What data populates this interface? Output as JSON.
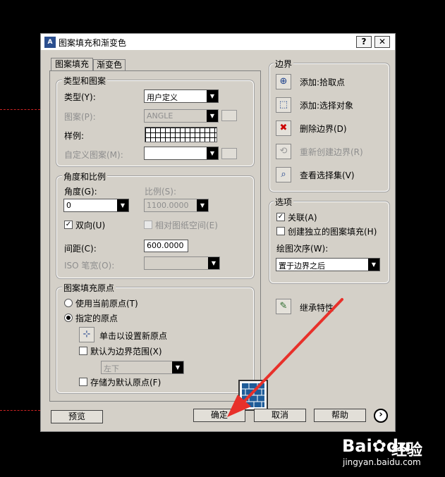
{
  "window": {
    "title": "图案填充和渐变色",
    "help_btn": "?",
    "close_btn": "✕",
    "app_icon_text": "A"
  },
  "tabs": [
    {
      "label": "图案填充"
    },
    {
      "label": "渐变色"
    }
  ],
  "type_pattern": {
    "title": "类型和图案",
    "type_label": "类型(Y):",
    "type_value": "用户定义",
    "pattern_label": "图案(P):",
    "pattern_value": "ANGLE",
    "sample_label": "样例:",
    "custom_label": "自定义图案(M):",
    "custom_value": ""
  },
  "angle_scale": {
    "title": "角度和比例",
    "angle_label": "角度(G):",
    "angle_value": "0",
    "scale_label": "比例(S):",
    "scale_value": "1100.0000",
    "double_label": "双向(U)",
    "relative_label": "相对图纸空间(E)",
    "spacing_label": "间距(C):",
    "spacing_value": "600.0000",
    "iso_label": "ISO 笔宽(O):",
    "iso_value": ""
  },
  "origin": {
    "title": "图案填充原点",
    "use_current_label": "使用当前原点(T)",
    "specified_label": "指定的原点",
    "click_set_label": "单击以设置新原点",
    "default_extent_label": "默认为边界范围(X)",
    "extent_value": "左下",
    "store_default_label": "存储为默认原点(F)"
  },
  "boundary": {
    "title": "边界",
    "add_pick_label": "添加:拾取点",
    "add_select_label": "添加:选择对象",
    "remove_label": "删除边界(D)",
    "recreate_label": "重新创建边界(R)",
    "view_label": "查看选择集(V)"
  },
  "options": {
    "title": "选项",
    "associative_label": "关联(A)",
    "separate_label": "创建独立的图案填充(H)",
    "draw_order_label": "绘图次序(W):",
    "draw_order_value": "置于边界之后"
  },
  "inherit_label": "继承特性",
  "buttons": {
    "preview": "预览",
    "ok": "确定",
    "cancel": "取消",
    "help": "帮助",
    "more": "›"
  },
  "watermark": {
    "brand_left": "Bai",
    "brand_right": "du",
    "brand_cn": "经验",
    "url": "jingyan.baidu.com"
  },
  "colors": {
    "dialog_bg": "#d4d0c8",
    "arrow": "#e8302a",
    "dash": "#cc2222"
  }
}
